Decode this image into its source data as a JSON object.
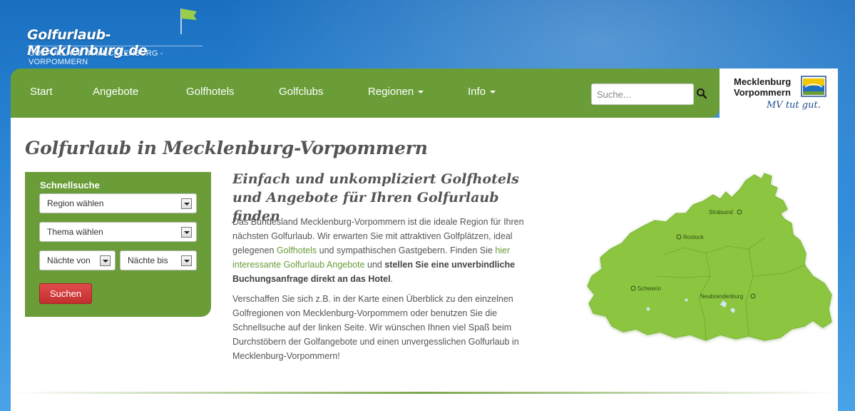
{
  "header": {
    "logo_text": "Golfurlaub-Mecklenburg.de",
    "logo_subtitle": "GOLFURLAUB IN MECKLENBURG - VORPOMMERN"
  },
  "nav": {
    "items": [
      {
        "label": "Start",
        "dropdown": false
      },
      {
        "label": "Angebote",
        "dropdown": false
      },
      {
        "label": "Golfhotels",
        "dropdown": false
      },
      {
        "label": "Golfclubs",
        "dropdown": false
      },
      {
        "label": "Regionen",
        "dropdown": true
      },
      {
        "label": "Info",
        "dropdown": true
      }
    ],
    "search_placeholder": "Suche...",
    "search_icon": "search-icon"
  },
  "mv_logo": {
    "line1": "Mecklenburg",
    "line2": "Vorpommern",
    "slogan": "MV tut gut."
  },
  "main": {
    "title": "Golfurlaub in Mecklenburg-Vorpommern",
    "quick_search": {
      "title": "Schnellsuche",
      "region": "Region wählen",
      "theme": "Thema wählen",
      "nights_from": "Nächte von",
      "nights_to": "Nächte bis",
      "submit": "Suchen"
    },
    "intro_heading": "Einfach und unkompliziert Golfhotels und Angebote für Ihren Golfurlaub finden",
    "paragraph1": {
      "part1": "Das Bundesland Mecklenburg-Vorpommern ist die ideale Region für Ihren nächsten Golfurlaub. Wir erwarten Sie mit attraktiven Golfplätzen, ideal gelegenen ",
      "link1": "Golfhotels",
      "part2": " und sympathischen Gastgebern. Finden Sie ",
      "link2": "hier interessante Golfurlaub Angebote",
      "part3": " und ",
      "bold": "stellen Sie eine unverbindliche Buchungsanfrage direkt an das Hotel",
      "part4": "."
    },
    "paragraph2": "Verschaffen Sie sich z.B. in der Karte einen Überblick zu den einzelnen Golfregionen von Mecklenburg-Vorpommern oder benutzen Sie die Schnellsuche auf der linken Seite. Wir wünschen Ihnen viel Spaß beim Durchstöbern der Golfangebote und einen unvergesslichen Golfurlaub in Mecklenburg-Vorpommern!",
    "map": {
      "cities": [
        "Stralsund",
        "Rostock",
        "Schwerin",
        "Neubrandenburg"
      ],
      "fill_color": "#8cc63f"
    }
  },
  "colors": {
    "nav_green": "#6a9d38",
    "button_red": "#c32f2f",
    "link_green": "#6a9d38"
  }
}
